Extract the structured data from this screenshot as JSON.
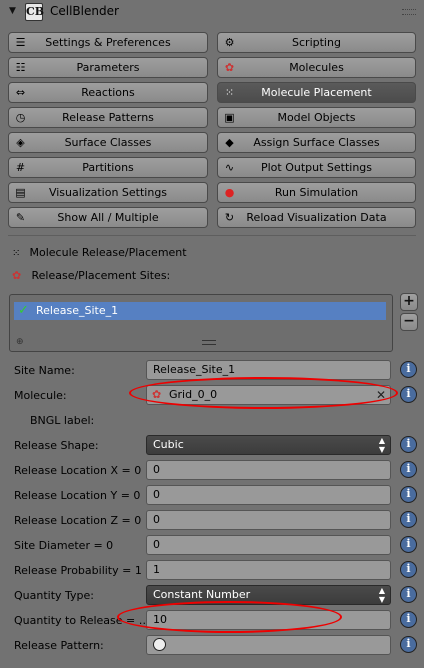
{
  "panel": {
    "title": "CellBlender",
    "logo_text": "CB"
  },
  "buttons": [
    {
      "label": "Settings & Preferences",
      "icon": "preferences-icon"
    },
    {
      "label": "Scripting",
      "icon": "script-icon"
    },
    {
      "label": "Parameters",
      "icon": "parameters-icon"
    },
    {
      "label": "Molecules",
      "icon": "molecules-icon"
    },
    {
      "label": "Reactions",
      "icon": "reactions-icon"
    },
    {
      "label": "Molecule Placement",
      "icon": "placement-icon"
    },
    {
      "label": "Release Patterns",
      "icon": "pattern-icon"
    },
    {
      "label": "Model Objects",
      "icon": "cube-icon"
    },
    {
      "label": "Surface Classes",
      "icon": "surface-icon"
    },
    {
      "label": "Assign Surface Classes",
      "icon": "assign-icon"
    },
    {
      "label": "Partitions",
      "icon": "grid-icon"
    },
    {
      "label": "Plot Output Settings",
      "icon": "plot-icon"
    },
    {
      "label": "Visualization Settings",
      "icon": "visualization-icon"
    },
    {
      "label": "Run Simulation",
      "icon": "run-icon"
    },
    {
      "label": "Show All / Multiple",
      "icon": "pin-icon"
    },
    {
      "label": "Reload Visualization Data",
      "icon": "reload-icon"
    }
  ],
  "section": {
    "title": "Molecule Release/Placement",
    "sites_label": "Release/Placement Sites:",
    "sites": [
      "Release_Site_1"
    ]
  },
  "form": {
    "site_name_label": "Site Name:",
    "site_name_value": "Release_Site_1",
    "molecule_label": "Molecule:",
    "molecule_value": "Grid_0_0",
    "bngl_label": "BNGL label:",
    "shape_label": "Release Shape:",
    "shape_value": "Cubic",
    "loc_x_label": "Release Location X = 0",
    "loc_x_value": "0",
    "loc_y_label": "Release Location Y = 0",
    "loc_y_value": "0",
    "loc_z_label": "Release Location Z = 0",
    "loc_z_value": "0",
    "diameter_label": "Site Diameter = 0",
    "diameter_value": "0",
    "probability_label": "Release Probability = 1",
    "probability_value": "1",
    "quantity_type_label": "Quantity Type:",
    "quantity_type_value": "Constant Number",
    "quantity_label": "Quantity to Release = …",
    "quantity_value": "10",
    "pattern_label": "Release Pattern:"
  },
  "colors": {
    "selection": "#5680c2",
    "highlight": "#e00000",
    "active_button": "#4c4c4c"
  }
}
